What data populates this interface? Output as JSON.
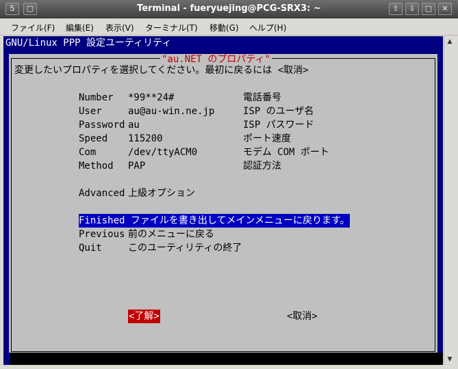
{
  "window": {
    "title": "Terminal - fueryuejing@PCG-SRX3: ~",
    "icon_label": "5"
  },
  "menubar": {
    "items": [
      "ファイル(F)",
      "編集(E)",
      "表示(V)",
      "ターミナル(T)",
      "移動(G)",
      "ヘルプ(H)"
    ]
  },
  "terminal": {
    "header": "GNU/Linux PPP 設定ユーティリティ",
    "dialog_title": "\"au.NET のプロパティ\"",
    "instruction": "変更したいプロパティを選択してください。最初に戻るには <取消>",
    "properties": [
      {
        "key": "Number",
        "value": "*99**24#",
        "desc": "電話番号"
      },
      {
        "key": "User",
        "value": "au@au-win.ne.jp",
        "desc": "ISP のユーザ名"
      },
      {
        "key": "Password",
        "value": "au",
        "desc": "ISP パスワード"
      },
      {
        "key": "Speed",
        "value": "115200",
        "desc": "ポート速度"
      },
      {
        "key": "Com",
        "value": "/dev/ttyACM0",
        "desc": "モデム COM ポート"
      },
      {
        "key": "Method",
        "value": "PAP",
        "desc": "認証方法"
      }
    ],
    "advanced": {
      "key": "Advanced",
      "desc": "上級オプション"
    },
    "actions": [
      {
        "key": "Finished",
        "desc": "ファイルを書き出してメインメニューに戻ります。",
        "selected": true
      },
      {
        "key": "Previous",
        "desc": "前のメニューに戻る",
        "selected": false
      },
      {
        "key": "Quit",
        "desc": "このユーティリティの終了",
        "selected": false
      }
    ],
    "ok_button": "<了解>",
    "cancel_button": "<取消>"
  },
  "colors": {
    "terminal_bg": "#000080",
    "dialog_bg": "#c0c0c0",
    "selection_bg": "#0000c0",
    "ok_button_bg": "#c00000",
    "dialog_title_color": "#c00000"
  }
}
